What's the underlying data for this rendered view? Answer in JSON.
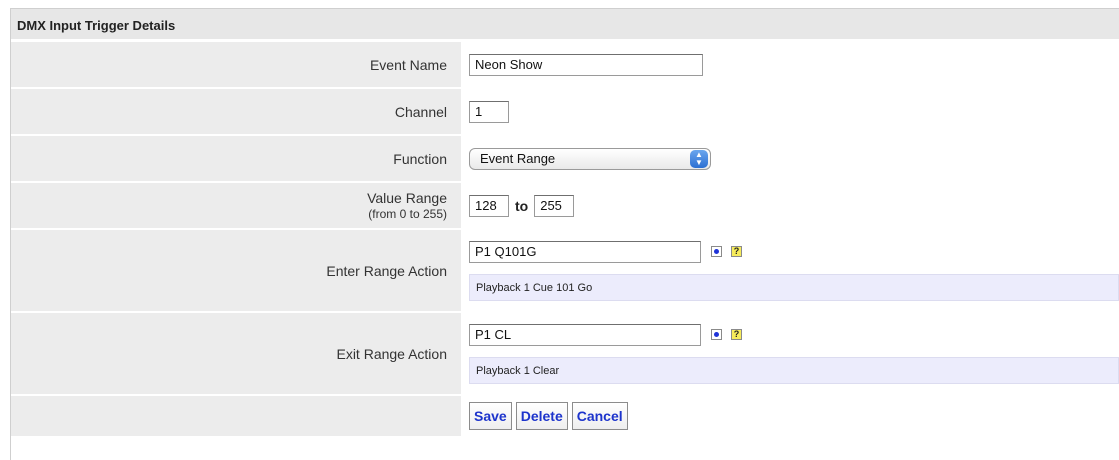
{
  "section_title": "DMX Input Trigger Details",
  "fields": {
    "event_name": {
      "label": "Event Name",
      "value": "Neon Show"
    },
    "channel": {
      "label": "Channel",
      "value": "1"
    },
    "function": {
      "label": "Function",
      "value": "Event Range"
    },
    "value_range": {
      "label": "Value Range",
      "sublabel": "(from 0 to 255)",
      "from": "128",
      "separator": "to",
      "to": "255"
    },
    "enter_action": {
      "label": "Enter Range Action",
      "value": "P1 Q101G",
      "description": "Playback 1 Cue 101 Go"
    },
    "exit_action": {
      "label": "Exit Range Action",
      "value": "P1 CL",
      "description": "Playback 1 Clear"
    }
  },
  "icons": {
    "select_dot": "dot-select-icon",
    "help": "help-icon",
    "help_glyph": "?"
  },
  "buttons": {
    "save": "Save",
    "delete": "Delete",
    "cancel": "Cancel"
  },
  "colors": {
    "button_text": "#1d34cc",
    "description_bg": "#ececfc",
    "label_bg": "#ececec"
  }
}
